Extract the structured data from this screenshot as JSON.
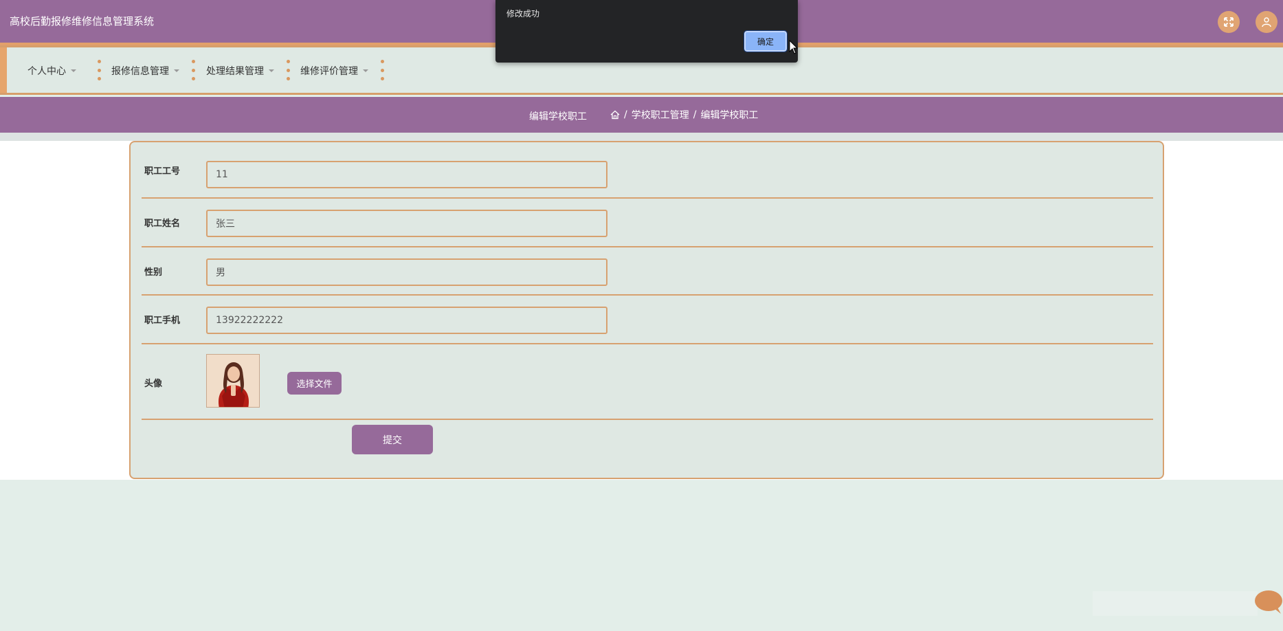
{
  "app": {
    "title": "高校后勤报修维修信息管理系统"
  },
  "header": {
    "fullscreen_icon": "expand-icon",
    "user_icon": "user-icon"
  },
  "nav": {
    "items": [
      {
        "label": "个人中心"
      },
      {
        "label": "报修信息管理"
      },
      {
        "label": "处理结果管理"
      },
      {
        "label": "维修评价管理"
      }
    ]
  },
  "breadcrumb": {
    "page_title": "编辑学校职工",
    "home_icon": "home-icon",
    "separator": "/",
    "parent": "学校职工管理",
    "current": "编辑学校职工"
  },
  "form": {
    "fields": [
      {
        "label": "职工工号",
        "value": "11"
      },
      {
        "label": "职工姓名",
        "value": "张三"
      },
      {
        "label": "性别",
        "value": "男"
      },
      {
        "label": "职工手机",
        "value": "13922222222"
      }
    ],
    "avatar_label": "头像",
    "choose_file_label": "选择文件",
    "submit_label": "提交"
  },
  "dialog": {
    "message": "修改成功",
    "ok_label": "确定"
  },
  "colors": {
    "primary_purple": "#966a9a",
    "accent_orange": "#d7a170",
    "panel_bg": "#dfe8e3",
    "dialog_bg": "#232426",
    "dialog_button": "#8ab4f8"
  }
}
